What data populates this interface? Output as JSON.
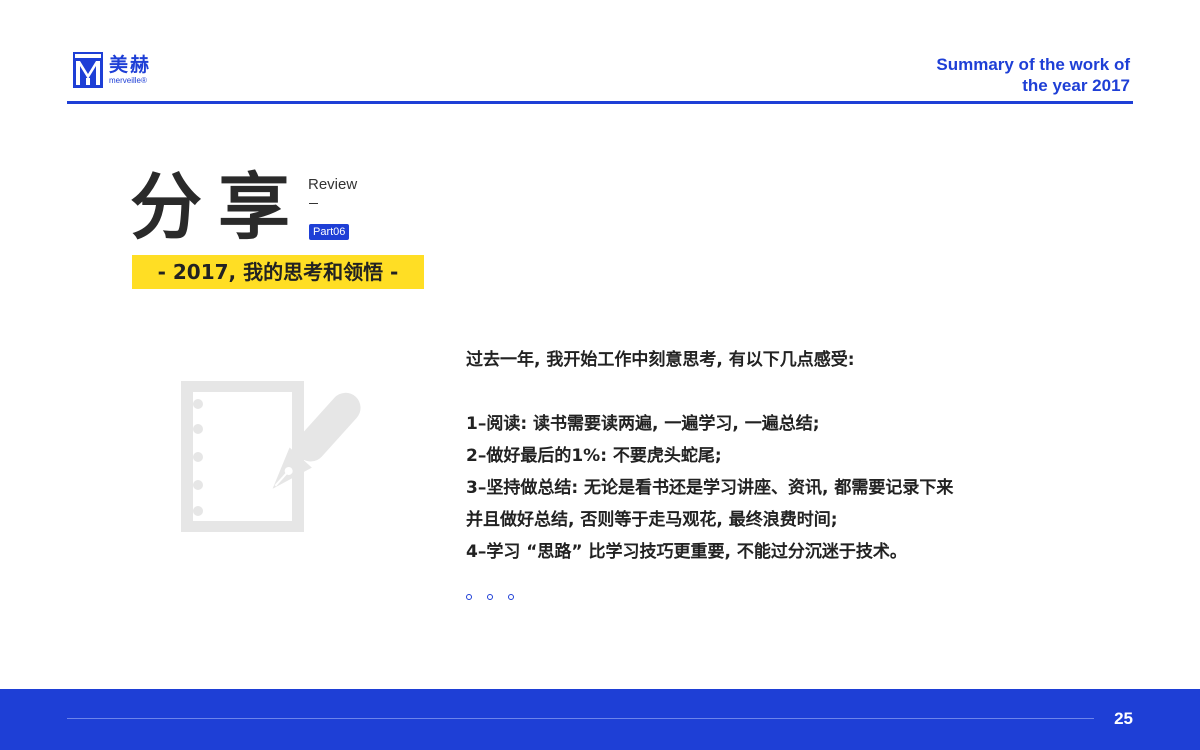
{
  "header": {
    "logo_cn": "美赫",
    "logo_en": "merveille®",
    "title_line1": "Summary of the work of",
    "title_line2": "the year 2017"
  },
  "section": {
    "title": "分享",
    "review_label": "Review",
    "review_dash": "–",
    "part_badge": "Part06",
    "subtitle": "- 2017, 我的思考和领悟 -"
  },
  "content": {
    "intro": "过去一年, 我开始工作中刻意思考, 有以下几点感受:",
    "points": [
      "1–阅读: 读书需要读两遍, 一遍学习, 一遍总结;",
      "2–做好最后的1%: 不要虎头蛇尾;",
      "3–坚持做总结: 无论是看书还是学习讲座、资讯, 都需要记录下来",
      "并且做好总结, 否则等于走马观花, 最终浪费时间;",
      "4–学习 “思路” 比学习技巧更重要, 不能过分沉迷于技术。"
    ]
  },
  "footer": {
    "page_number": "25"
  },
  "colors": {
    "brand_blue": "#1e3fd6",
    "highlight_yellow": "#ffde24",
    "icon_gray": "#e6e6e6"
  },
  "icons": [
    "merveille-logo-icon",
    "document-pen-icon",
    "ellipsis-dots-icon"
  ]
}
